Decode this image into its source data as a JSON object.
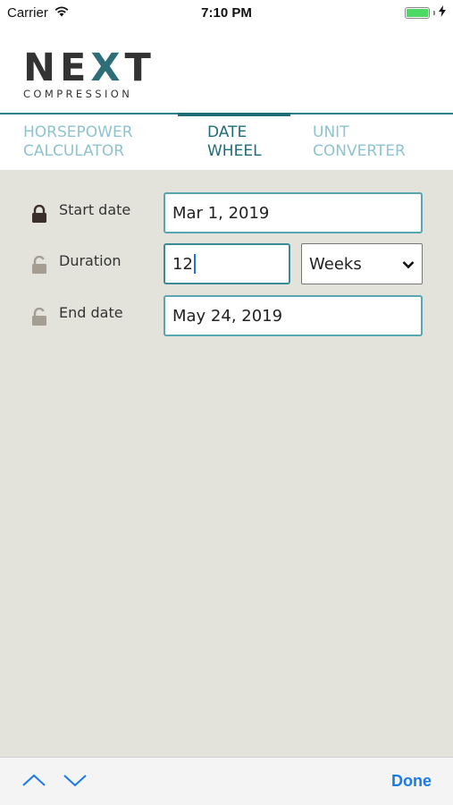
{
  "status_bar": {
    "carrier": "Carrier",
    "time": "7:10 PM",
    "wifi_icon": "wifi-icon",
    "battery_icon": "battery-icon",
    "charging_icon": "charging-bolt-icon"
  },
  "brand": {
    "name_part1": "NE",
    "name_x": "X",
    "name_part2": "T",
    "tagline": "COMPRESSION",
    "accent_color": "#2e6e78"
  },
  "tabs": [
    {
      "line1": "HORSEPOWER",
      "line2": "CALCULATOR",
      "active": false
    },
    {
      "line1": "DATE",
      "line2": "WHEEL",
      "active": true
    },
    {
      "line1": "UNIT",
      "line2": "CONVERTER",
      "active": false
    }
  ],
  "form": {
    "start_date": {
      "label": "Start date",
      "value": "Mar 1, 2019",
      "locked": true
    },
    "duration": {
      "label": "Duration",
      "value": "12",
      "unit": "Weeks",
      "locked": false
    },
    "end_date": {
      "label": "End date",
      "value": "May 24, 2019",
      "locked": false
    }
  },
  "toolbar": {
    "prev_icon": "chevron-up-icon",
    "next_icon": "chevron-down-icon",
    "done_label": "Done"
  },
  "colors": {
    "accent": "#1f6d77",
    "tab_inactive": "#8fc3cf",
    "panel_bg": "#e3e3dc",
    "field_border": "#57a6b4",
    "done_blue": "#1a7ae6"
  }
}
